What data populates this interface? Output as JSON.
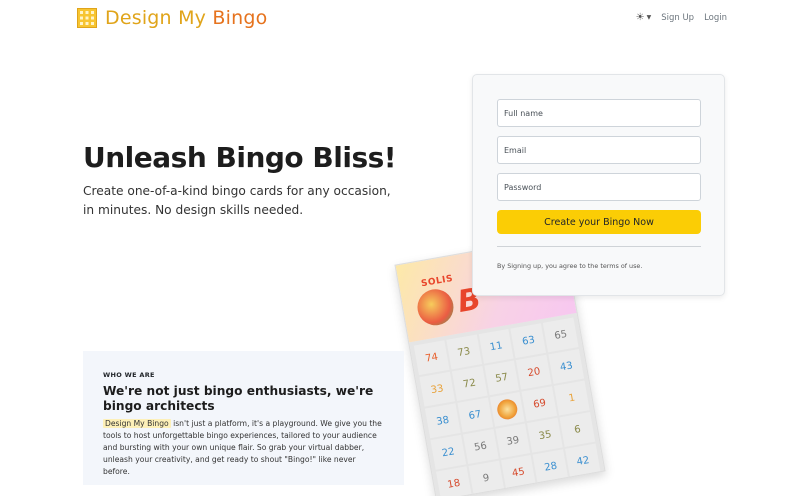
{
  "header": {
    "brand": {
      "word1": "Design",
      "word2": "My",
      "word3": "Bingo"
    },
    "theme_icon": "sun-icon",
    "nav": {
      "signup": "Sign Up",
      "login": "Login"
    }
  },
  "hero": {
    "title": "Unleash Bingo Bliss!",
    "subtitle": "Create one-of-a-kind bingo cards for any occasion, in minutes. No design skills needed."
  },
  "form": {
    "fullname_placeholder": "Full name",
    "email_placeholder": "Email",
    "password_placeholder": "Password",
    "submit_label": "Create your Bingo Now",
    "terms": "By Signing up, you agree to the terms of use."
  },
  "bingo_card": {
    "header_text": "SOLIS",
    "header_letter": "B",
    "cells": [
      {
        "n": "74",
        "c": "#e8602c"
      },
      {
        "n": "73",
        "c": "#8a8a4a"
      },
      {
        "n": "11",
        "c": "#3a8fd0"
      },
      {
        "n": "63",
        "c": "#3a8fd0"
      },
      {
        "n": "65",
        "c": "#7a7a7a"
      },
      {
        "n": "33",
        "c": "#e8a23a"
      },
      {
        "n": "72",
        "c": "#8a8a4a"
      },
      {
        "n": "57",
        "c": "#8a8a4a"
      },
      {
        "n": "20",
        "c": "#d64a2c"
      },
      {
        "n": "43",
        "c": "#3a8fd0"
      },
      {
        "n": "38",
        "c": "#3a8fd0"
      },
      {
        "n": "67",
        "c": "#3a8fd0"
      },
      {
        "n": "",
        "c": "",
        "free": true
      },
      {
        "n": "69",
        "c": "#d64a2c"
      },
      {
        "n": "1",
        "c": "#e8a23a"
      },
      {
        "n": "22",
        "c": "#3a8fd0"
      },
      {
        "n": "56",
        "c": "#7a7a7a"
      },
      {
        "n": "39",
        "c": "#7a7a7a"
      },
      {
        "n": "35",
        "c": "#8a8a4a"
      },
      {
        "n": "6",
        "c": "#8a8a4a"
      },
      {
        "n": "18",
        "c": "#d64a2c"
      },
      {
        "n": "9",
        "c": "#7a7a7a"
      },
      {
        "n": "45",
        "c": "#d64a2c"
      },
      {
        "n": "28",
        "c": "#3a8fd0"
      },
      {
        "n": "42",
        "c": "#3a8fd0"
      }
    ]
  },
  "who": {
    "label": "WHO WE ARE",
    "title": "We're not just bingo enthusiasts, we're bingo architects",
    "highlight": "Design My Bingo",
    "text": " isn't just a platform, it's a playground. We give you the tools to host unforgettable bingo experiences, tailored to your audience and bursting with your own unique flair. So grab your virtual dabber, unleash your creativity, and get ready to shout \"Bingo!\" like never before."
  },
  "colors": {
    "accent": "#fbcd05",
    "brand": "#e0a41a",
    "brand_alt": "#e6731e"
  }
}
